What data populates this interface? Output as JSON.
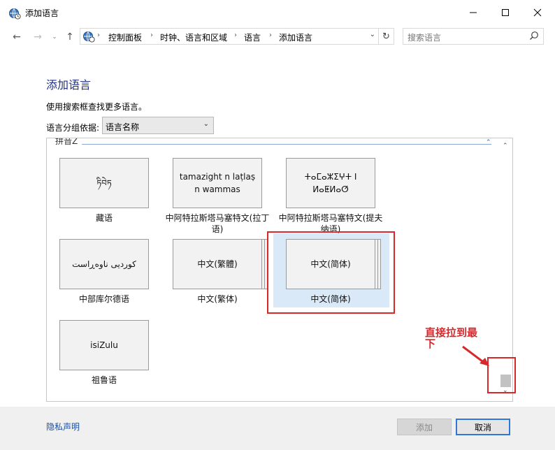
{
  "window": {
    "title": "添加语言"
  },
  "address_bar": {
    "crumbs": [
      "控制面板",
      "时钟、语言和区域",
      "语言",
      "添加语言"
    ]
  },
  "search": {
    "placeholder": "搜索语言"
  },
  "content": {
    "heading": "添加语言",
    "description": "使用搜索框查找更多语言。",
    "group_label": "语言分组依据:",
    "group_select_value": "语言名称",
    "group_header": "拼音Z"
  },
  "tiles": [
    {
      "card": "ཏིབེཏ",
      "name": "藏语"
    },
    {
      "card": "tamazight n laṭlaṣ n wammas",
      "name": "中阿特拉斯塔马塞特文(拉丁语)"
    },
    {
      "card": "ⵜⴰⵎⴰⵣⵉⵖⵜ ⵏ ⵍⴰⵟⵍⴰⵚ",
      "name": "中阿特拉斯塔马塞特文(提夫纳语)"
    },
    {
      "card": "کوردیی ناوەڕاست",
      "name": "中部库尔德语"
    },
    {
      "card": "中文(繁體)",
      "name": "中文(繁体)"
    },
    {
      "card": "中文(简体)",
      "name": "中文(简体)"
    },
    {
      "card": "isiZulu",
      "name": "祖鲁语"
    }
  ],
  "annotation": {
    "text": "直接拉到最下"
  },
  "footer": {
    "privacy_link": "隐私声明",
    "add_button": "添加",
    "cancel_button": "取消"
  },
  "colors": {
    "accent": "#1e3287",
    "annotation": "#d9282c",
    "selection": "#d9e9f7"
  }
}
